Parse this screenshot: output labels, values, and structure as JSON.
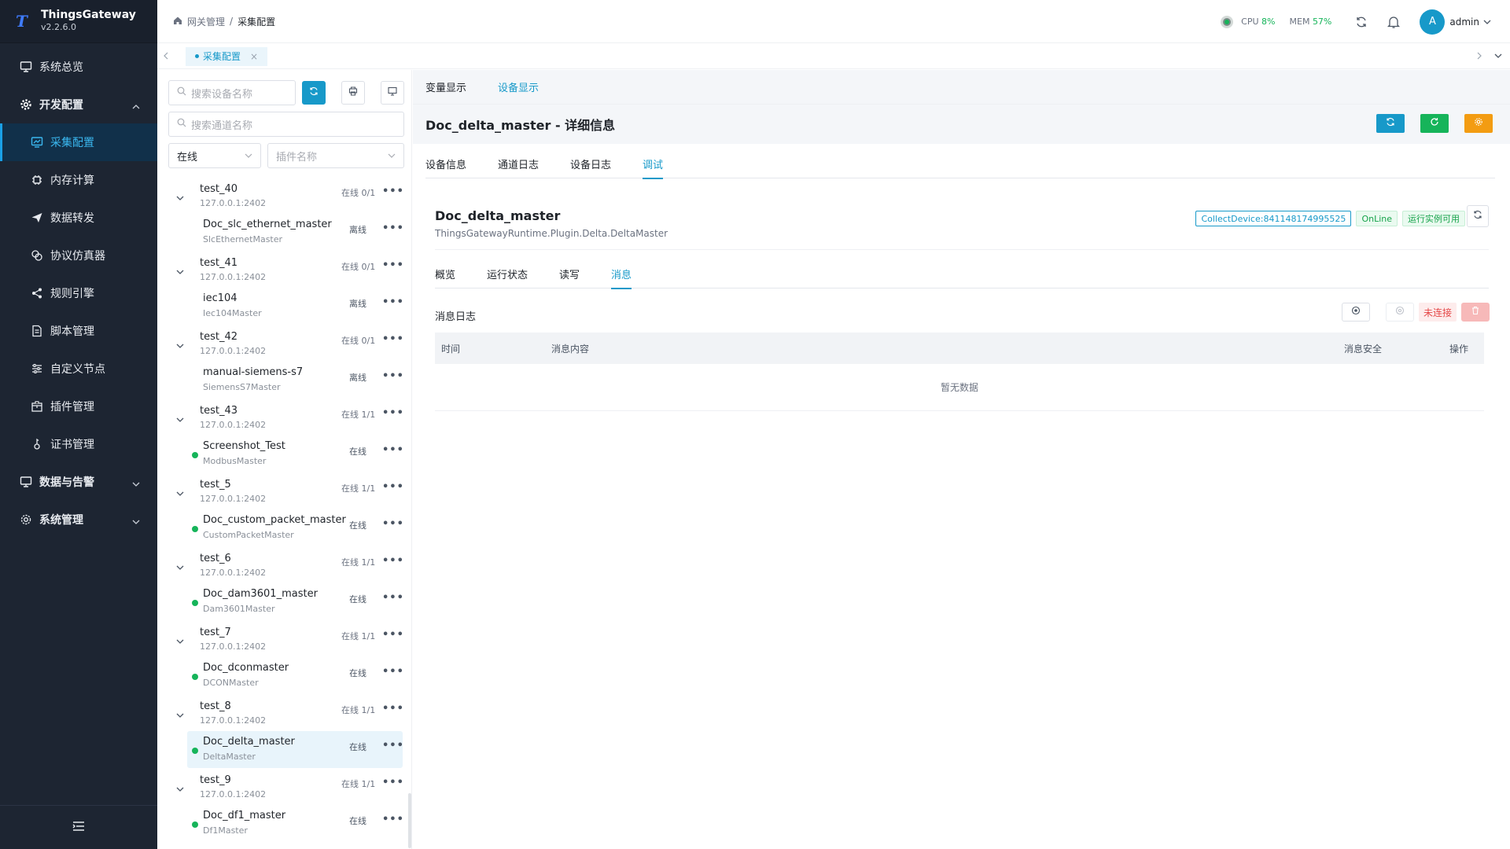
{
  "app": {
    "name": "ThingsGateway",
    "version": "v2.2.6.0"
  },
  "sidebar": {
    "items": [
      {
        "label": "系统总览",
        "icon": "monitor-icon"
      },
      {
        "label": "开发配置",
        "icon": "gear-icon"
      },
      {
        "label": "采集配置",
        "icon": "chart-screen-icon"
      },
      {
        "label": "内存计算",
        "icon": "chip-icon"
      },
      {
        "label": "数据转发",
        "icon": "send-icon"
      },
      {
        "label": "协议仿真器",
        "icon": "copy-icon"
      },
      {
        "label": "规则引擎",
        "icon": "share-icon"
      },
      {
        "label": "脚本管理",
        "icon": "document-icon"
      },
      {
        "label": "自定义节点",
        "icon": "sliders-icon"
      },
      {
        "label": "插件管理",
        "icon": "package-icon"
      },
      {
        "label": "证书管理",
        "icon": "key-icon"
      },
      {
        "label": "数据与告警",
        "icon": "monitor-icon"
      },
      {
        "label": "系统管理",
        "icon": "gear-icon"
      }
    ]
  },
  "header": {
    "breadcrumb": [
      "网关管理",
      "/",
      "采集配置"
    ],
    "cpu_label": "CPU",
    "cpu_value": "8%",
    "mem_label": "MEM",
    "mem_value": "57%",
    "avatar_letter": "A",
    "user": "admin"
  },
  "tabstrip": {
    "tab_label": "采集配置",
    "close": "×"
  },
  "devpanel": {
    "search_device_placeholder": "搜索设备名称",
    "search_channel_placeholder": "搜索通道名称",
    "status_select": "在线",
    "plugin_select_placeholder": "插件名称",
    "groups": [
      {
        "name": "test_40",
        "ip": "127.0.0.1:2402",
        "status": "在线 0/1",
        "device": {
          "name": "Doc_slc_ethernet_master",
          "plugin": "SlcEthernetMaster",
          "status": "离线",
          "online": false
        }
      },
      {
        "name": "test_41",
        "ip": "127.0.0.1:2402",
        "status": "在线 0/1",
        "device": {
          "name": "iec104",
          "plugin": "Iec104Master",
          "status": "离线",
          "online": false
        }
      },
      {
        "name": "test_42",
        "ip": "127.0.0.1:2402",
        "status": "在线 0/1",
        "device": {
          "name": "manual-siemens-s7",
          "plugin": "SiemensS7Master",
          "status": "离线",
          "online": false
        }
      },
      {
        "name": "test_43",
        "ip": "127.0.0.1:2402",
        "status": "在线 1/1",
        "device": {
          "name": "Screenshot_Test",
          "plugin": "ModbusMaster",
          "status": "在线",
          "online": true
        }
      },
      {
        "name": "test_5",
        "ip": "127.0.0.1:2402",
        "status": "在线 1/1",
        "device": {
          "name": "Doc_custom_packet_master",
          "plugin": "CustomPacketMaster",
          "status": "在线",
          "online": true
        }
      },
      {
        "name": "test_6",
        "ip": "127.0.0.1:2402",
        "status": "在线 1/1",
        "device": {
          "name": "Doc_dam3601_master",
          "plugin": "Dam3601Master",
          "status": "在线",
          "online": true
        }
      },
      {
        "name": "test_7",
        "ip": "127.0.0.1:2402",
        "status": "在线 1/1",
        "device": {
          "name": "Doc_dconmaster",
          "plugin": "DCONMaster",
          "status": "在线",
          "online": true
        }
      },
      {
        "name": "test_8",
        "ip": "127.0.0.1:2402",
        "status": "在线 1/1",
        "device": {
          "name": "Doc_delta_master",
          "plugin": "DeltaMaster",
          "status": "在线",
          "online": true,
          "selected": true
        }
      },
      {
        "name": "test_9",
        "ip": "127.0.0.1:2402",
        "status": "在线 1/1",
        "device": {
          "name": "Doc_df1_master",
          "plugin": "Df1Master",
          "status": "在线",
          "online": true
        }
      }
    ]
  },
  "main": {
    "view_tabs": [
      "变量显示",
      "设备显示"
    ],
    "detail_title": "Doc_delta_master - 详细信息",
    "sub_tabs": [
      "设备信息",
      "通道日志",
      "设备日志",
      "调试"
    ],
    "device_name": "Doc_delta_master",
    "device_plugin": "ThingsGatewayRuntime.Plugin.Delta.DeltaMaster",
    "tag_collect": "CollectDevice:841148174995525",
    "tag_online": "OnLine",
    "tag_runtime": "运行实例可用",
    "inner_tabs": [
      "概览",
      "运行状态",
      "读写",
      "消息"
    ],
    "log_title": "消息日志",
    "not_connected": "未连接",
    "table_headers": [
      "时间",
      "消息内容",
      "消息安全",
      "操作"
    ],
    "empty_text": "暂无数据"
  },
  "colors": {
    "sidebar_bg": "#1d2532",
    "accent": "#1799c9",
    "green": "#16b45a",
    "orange": "#f39c12",
    "red": "#e54848"
  }
}
